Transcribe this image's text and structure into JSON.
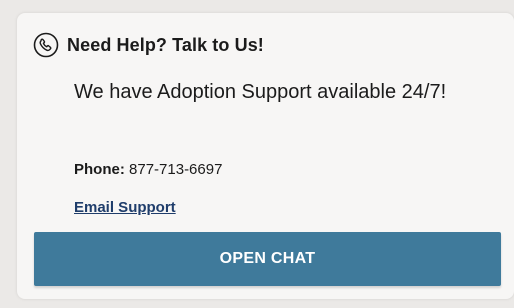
{
  "help_card": {
    "title": "Need Help? Talk to Us!",
    "title_icon": "phone-call-icon",
    "description": "We have Adoption Support available 24/7!",
    "phone_label": "Phone:",
    "phone_number": "877-713-6697",
    "email_link": "Email Support",
    "chat_button": "OPEN CHAT"
  },
  "colors": {
    "page_background": "#ebe9e7",
    "card_background": "#f7f6f5",
    "button": "#3f7a9b",
    "link": "#1f3d6b",
    "text": "#1b1b1b"
  }
}
